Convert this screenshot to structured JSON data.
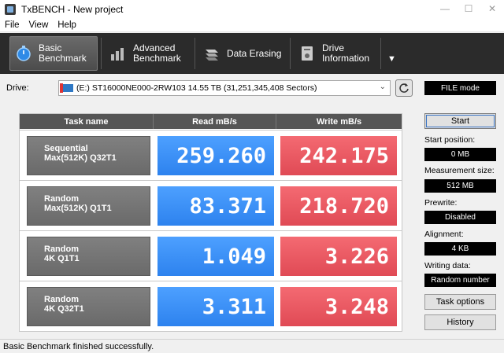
{
  "window": {
    "title": "TxBENCH - New project",
    "min": "—",
    "max": "☐",
    "close": "✕"
  },
  "menu": [
    {
      "label": "File"
    },
    {
      "label": "View"
    },
    {
      "label": "Help"
    }
  ],
  "toolbar": {
    "tabs": [
      {
        "line1": "Basic",
        "line2": "Benchmark",
        "icon": "stopwatch-icon"
      },
      {
        "line1": "Advanced",
        "line2": "Benchmark",
        "icon": "bar-chart-icon"
      },
      {
        "line1": "Data Erasing",
        "line2": "",
        "icon": "eraser-icon"
      },
      {
        "line1": "Drive",
        "line2": "Information",
        "icon": "drive-info-icon"
      }
    ],
    "more_glyph": "▼"
  },
  "drive": {
    "label": "Drive:",
    "value": "(E:) ST16000NE000-2RW103  14.55 TB (31,251,345,408 Sectors)",
    "chevron": "⌄",
    "mode": "FILE mode"
  },
  "bench": {
    "headers": {
      "task": "Task name",
      "read": "Read mB/s",
      "write": "Write mB/s"
    },
    "rows": [
      {
        "line1": "Sequential",
        "line2": "Max(512K) Q32T1",
        "read": "259.260",
        "write": "242.175"
      },
      {
        "line1": "Random",
        "line2": "Max(512K) Q1T1",
        "read": "83.371",
        "write": "218.720"
      },
      {
        "line1": "Random",
        "line2": "4K Q1T1",
        "read": "1.049",
        "write": "3.226"
      },
      {
        "line1": "Random",
        "line2": "4K Q32T1",
        "read": "3.311",
        "write": "3.248"
      }
    ]
  },
  "side": {
    "start": "Start",
    "start_position_label": "Start position:",
    "start_position": "0 MB",
    "measurement_size_label": "Measurement size:",
    "measurement_size": "512 MB",
    "prewrite_label": "Prewrite:",
    "prewrite": "Disabled",
    "alignment_label": "Alignment:",
    "alignment": "4 KB",
    "writing_data_label": "Writing data:",
    "writing_data": "Random number",
    "task_options": "Task options",
    "history": "History"
  },
  "status": {
    "text": "Basic Benchmark finished successfully."
  },
  "colors": {
    "read": "#2d82ee",
    "write": "#e04a55",
    "toolbar": "#2b2b2b"
  }
}
